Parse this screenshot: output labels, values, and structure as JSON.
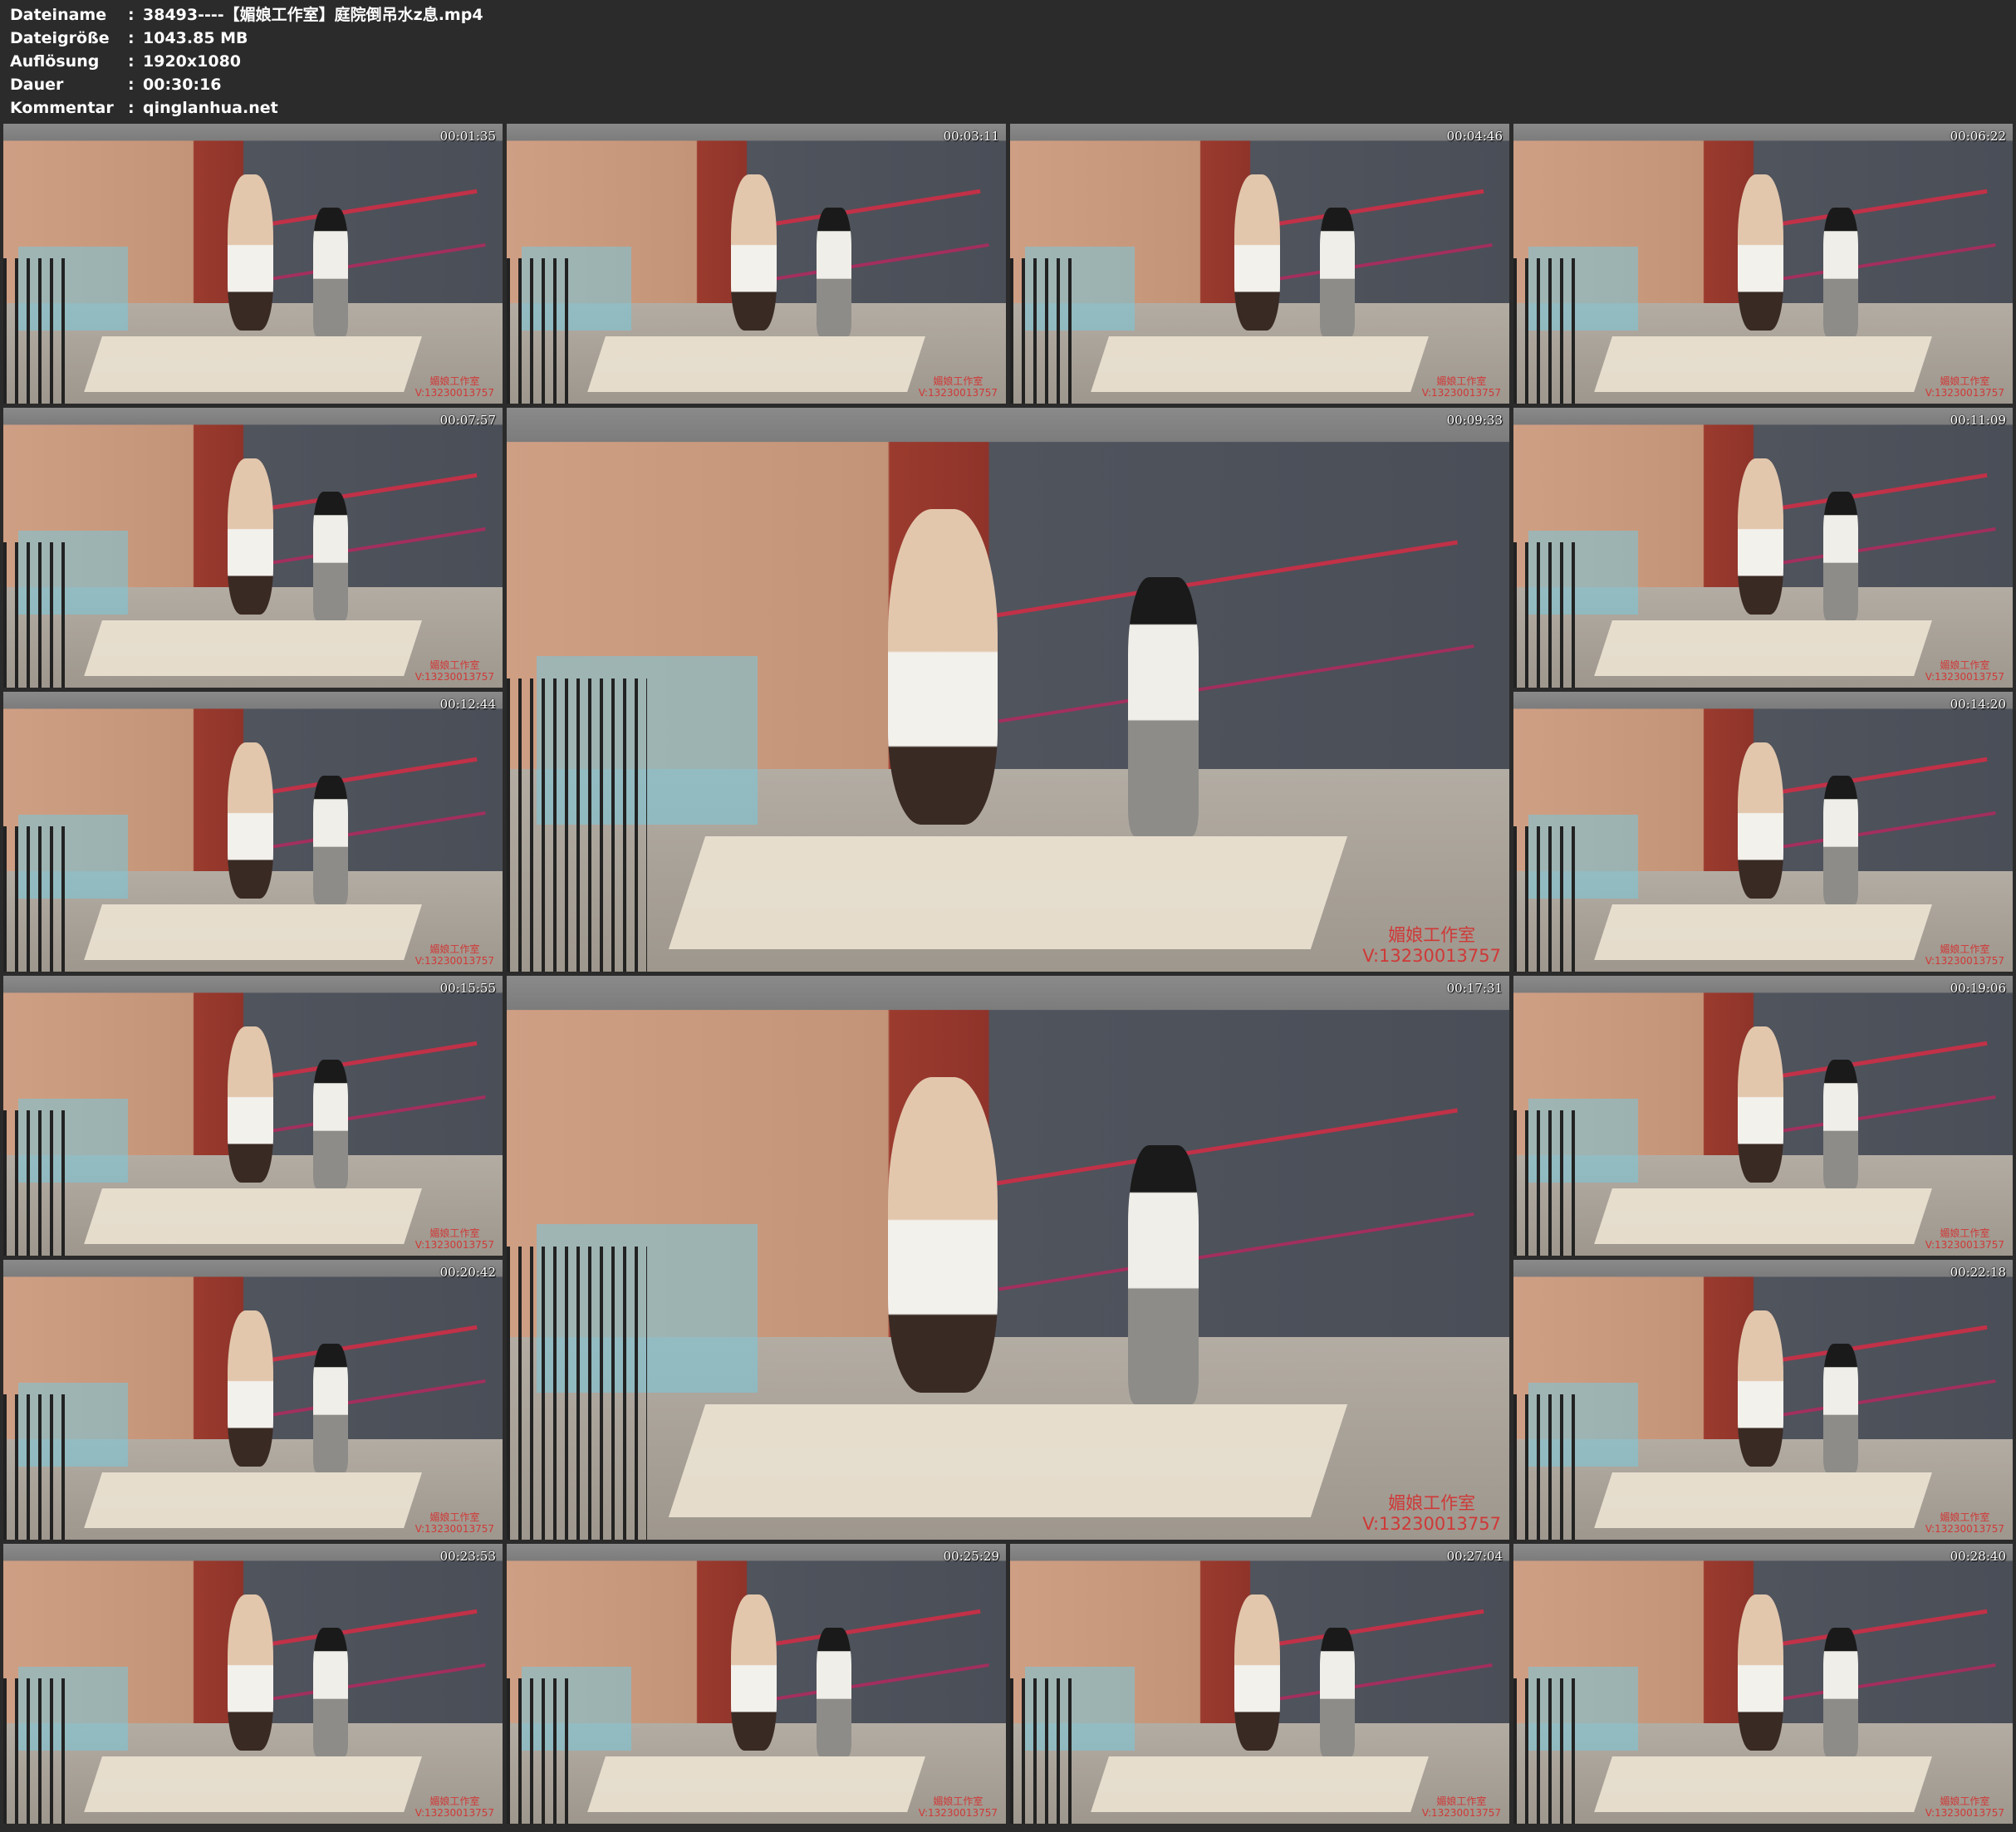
{
  "header": {
    "rows": [
      {
        "key": "Dateiname",
        "sep": ":",
        "value": "38493----【媚娘工作室】庭院倒吊水z息.mp4"
      },
      {
        "key": "Dateigröße",
        "sep": ":",
        "value": "1043.85 MB"
      },
      {
        "key": "Auflösung",
        "sep": ":",
        "value": "1920x1080"
      },
      {
        "key": "Dauer",
        "sep": ":",
        "value": "00:30:16"
      },
      {
        "key": "Kommentar",
        "sep": ":",
        "value": "qinglanhua.net"
      }
    ]
  },
  "thumbnails": [
    {
      "timestamp": "00:01:35",
      "watermark": [
        "媚娘工作室",
        "V:13230013757"
      ]
    },
    {
      "timestamp": "00:03:11",
      "watermark": [
        "媚娘工作室",
        "V:13230013757"
      ]
    },
    {
      "timestamp": "00:04:46",
      "watermark": [
        "媚娘工作室",
        "V:13230013757"
      ]
    },
    {
      "timestamp": "00:06:22",
      "watermark": [
        "媚娘工作室",
        "V:13230013757"
      ]
    },
    {
      "timestamp": "00:07:57",
      "watermark": [
        "媚娘工作室",
        "V:13230013757"
      ]
    },
    {
      "timestamp": "00:09:33",
      "watermark": [
        "媚娘工作室",
        "V:13230013757"
      ]
    },
    {
      "timestamp": "00:11:09",
      "watermark": [
        "媚娘工作室",
        "V:13230013757"
      ]
    },
    {
      "timestamp": "00:12:44",
      "watermark": [
        "媚娘工作室",
        "V:13230013757"
      ]
    },
    {
      "timestamp": "00:14:20",
      "watermark": [
        "媚娘工作室",
        "V:13230013757"
      ]
    },
    {
      "timestamp": "00:15:55",
      "watermark": [
        "媚娘工作室",
        "V:13230013757"
      ]
    },
    {
      "timestamp": "00:17:31",
      "watermark": [
        "媚娘工作室",
        "V:13230013757"
      ]
    },
    {
      "timestamp": "00:19:06",
      "watermark": [
        "媚娘工作室",
        "V:13230013757"
      ]
    },
    {
      "timestamp": "00:20:42",
      "watermark": [
        "媚娘工作室",
        "V:13230013757"
      ]
    },
    {
      "timestamp": "00:22:18",
      "watermark": [
        "媚娘工作室",
        "V:13230013757"
      ]
    },
    {
      "timestamp": "00:23:53",
      "watermark": [
        "媚娘工作室",
        "V:13230013757"
      ]
    },
    {
      "timestamp": "00:25:29",
      "watermark": [
        "媚娘工作室",
        "V:13230013757"
      ]
    },
    {
      "timestamp": "00:27:04",
      "watermark": [
        "媚娘工作室",
        "V:13230013757"
      ]
    },
    {
      "timestamp": "00:28:40",
      "watermark": [
        "媚娘工作室",
        "V:13230013757"
      ]
    }
  ]
}
